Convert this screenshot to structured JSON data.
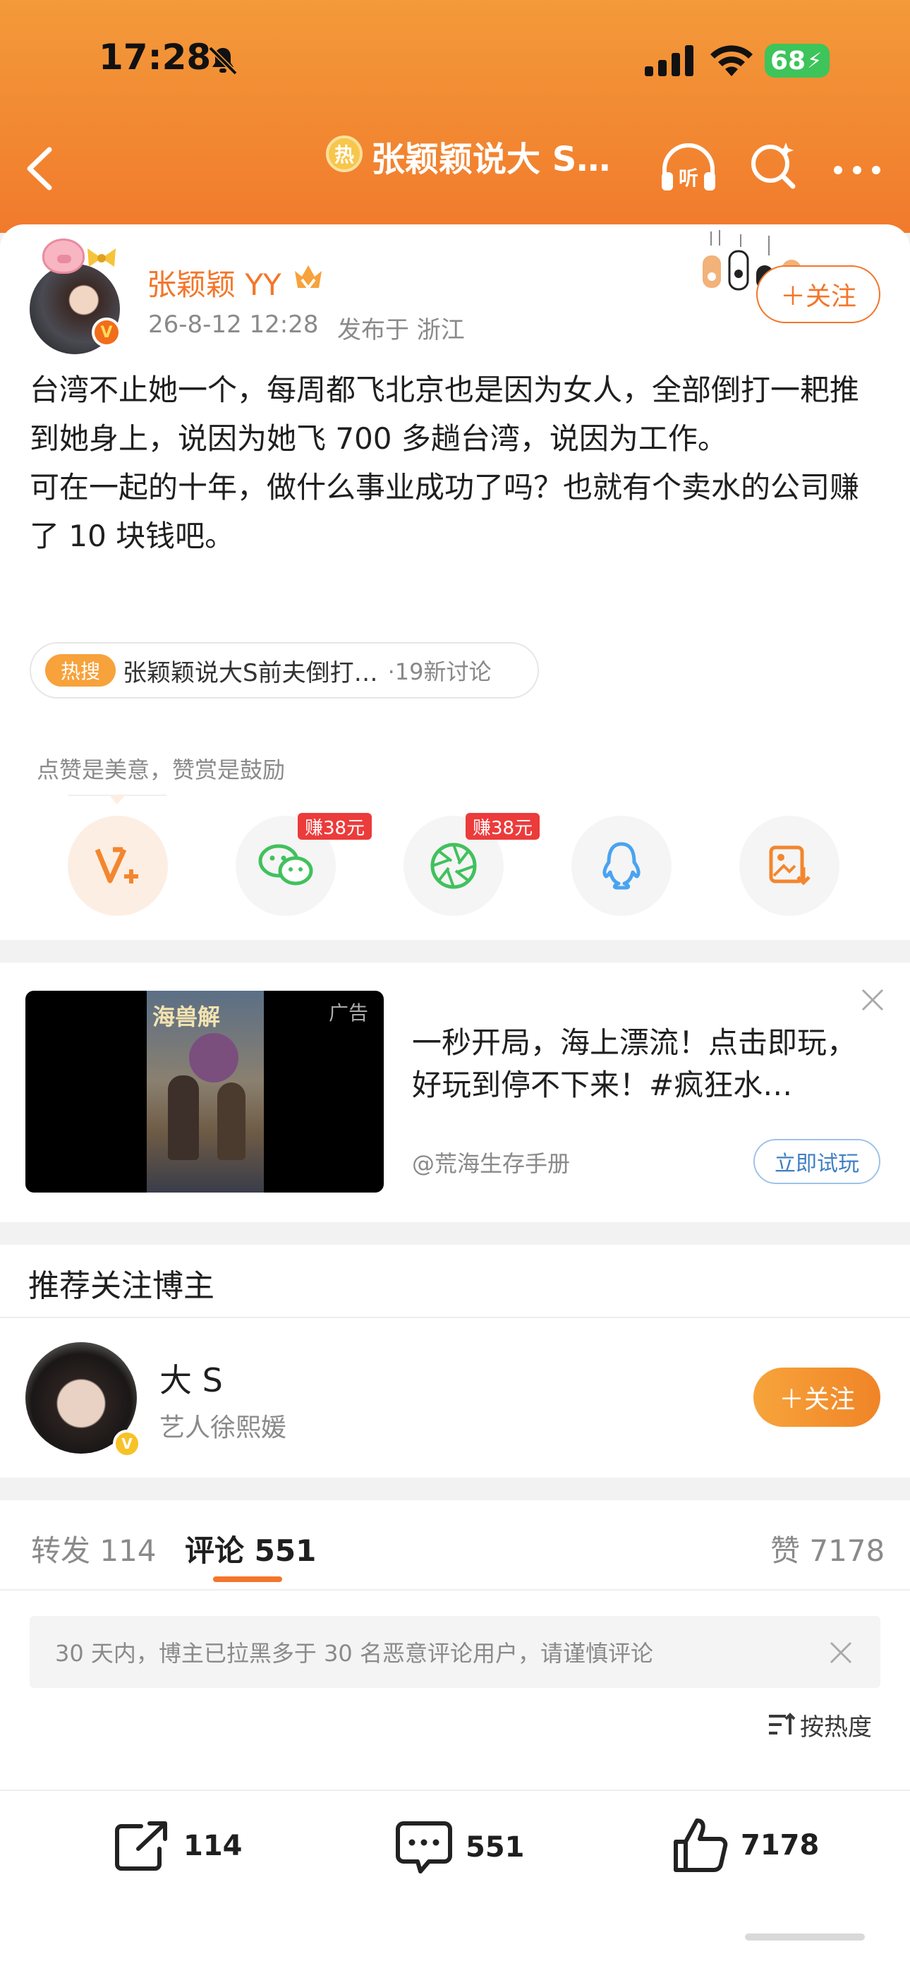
{
  "status_bar": {
    "time": "17:28",
    "battery": "68"
  },
  "nav": {
    "hot_icon": "热",
    "title": "张颖颖说大 S…"
  },
  "post": {
    "author_name": "张颖颖 YY",
    "time": "26-8-12 12:28",
    "location": "发布于 浙江",
    "follow_label": "＋关注",
    "text": "台湾不止她一个，每周都飞北京也是因为女人，全部倒打一耙推到她身上，说因为她飞 700 多趟台湾，说因为工作。\n可在一起的十年，做什么事业成功了吗？也就有个卖水的公司赚了 10 块钱吧。",
    "topic": {
      "tag": "热搜",
      "text": "张颖颖说大S前夫倒打…",
      "count": "·19新讨论"
    },
    "like_hint": "点赞是美意，赞赏是鼓励",
    "share": {
      "wechat_reward": "赚38元",
      "moments_reward": "赚38元"
    }
  },
  "ad": {
    "label": "广告",
    "poster_title": "海兽解",
    "text": "一秒开局，海上漂流！点击即玩，好玩到停不下来！#疯狂水…",
    "source": "@荒海生存手册",
    "button": "立即试玩"
  },
  "recommend": {
    "title": "推荐关注博主",
    "name": "大 S",
    "desc": "艺人徐熙媛",
    "follow_label": "＋关注"
  },
  "comments": {
    "tab_repost": "转发  114",
    "tab_comment": "评论  551",
    "tab_like": "赞  7178",
    "notice": "30 天内，博主已拉黑多于 30 名恶意评论用户，请谨慎评论",
    "sort_label": "按热度"
  },
  "bottom_bar": {
    "repost": "114",
    "comment": "551",
    "like": "7178"
  },
  "colors": {
    "accent": "#f3762a",
    "header": "#f17a2c",
    "earn": "#ec3b3b"
  }
}
